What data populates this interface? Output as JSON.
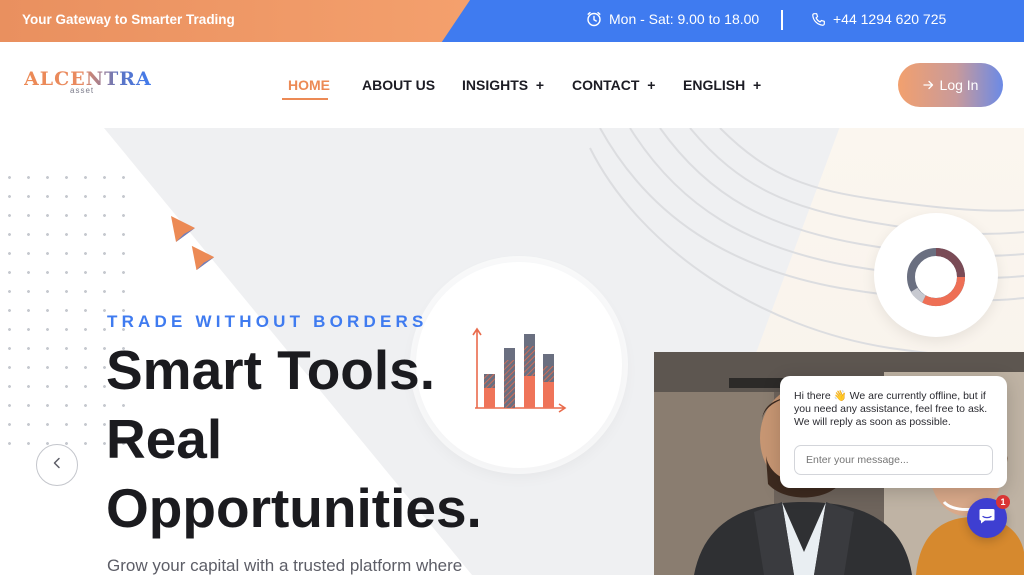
{
  "topbar": {
    "tagline": "Your Gateway to Smarter Trading",
    "hours": "Mon - Sat: 9.00 to 18.00",
    "phone": "+44 1294 620 725",
    "colors": {
      "left_accent": "#f4a06d",
      "right_accent": "#3f7bf0"
    }
  },
  "nav": {
    "logo": {
      "main": "ALCENTRA",
      "sub": "asset"
    },
    "items": [
      {
        "label": "HOME",
        "active": true
      },
      {
        "label": "ABOUT US"
      },
      {
        "label": "INSIGHTS",
        "suffix": "+"
      },
      {
        "label": "CONTACT",
        "suffix": "+"
      },
      {
        "label": "ENGLISH",
        "suffix": "+"
      }
    ],
    "login_label": "Log In"
  },
  "hero": {
    "eyebrow": "TRADE WITHOUT BORDERS",
    "headline_lines": [
      "Smart Tools.",
      "Real",
      "Opportunities."
    ],
    "subline": "Grow your capital with a trusted platform where",
    "icons": [
      "bar-chart-icon",
      "donut-chart-icon",
      "chevron-left-icon"
    ]
  },
  "chat": {
    "message": "Hi there 👋 We are currently offline, but if you need any assistance, feel free to ask. We will reply as soon as possible.",
    "input_placeholder": "Enter your message...",
    "unread_count": "1"
  },
  "colors": {
    "brand_orange": "#ec8a55",
    "brand_blue": "#3f7bf0",
    "chat_blue": "#3e3fd1"
  }
}
